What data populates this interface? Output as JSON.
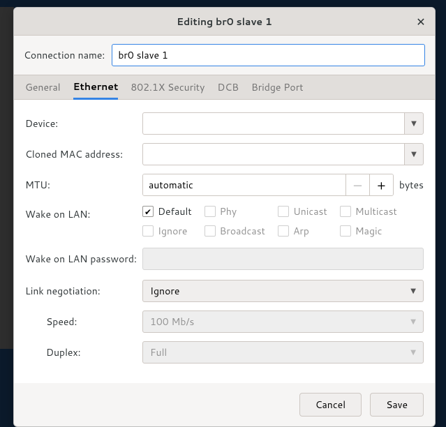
{
  "titlebar": {
    "title": "Editing br0 slave 1"
  },
  "connection_name": {
    "label": "Connection name:",
    "value": "br0 slave 1"
  },
  "tabs": {
    "general": "General",
    "ethernet": "Ethernet",
    "security": "802.1X Security",
    "dcb": "DCB",
    "bridge": "Bridge Port"
  },
  "ethernet": {
    "device": {
      "label": "Device:",
      "value": ""
    },
    "cloned_mac": {
      "label": "Cloned MAC address:",
      "value": ""
    },
    "mtu": {
      "label": "MTU:",
      "value": "automatic",
      "unit": "bytes"
    },
    "wol": {
      "label": "Wake on LAN:",
      "default": {
        "label": "Default",
        "checked": true
      },
      "phy": {
        "label": "Phy",
        "checked": false
      },
      "unicast": {
        "label": "Unicast",
        "checked": false
      },
      "multicast": {
        "label": "Multicast",
        "checked": false
      },
      "ignore": {
        "label": "Ignore",
        "checked": false
      },
      "broadcast": {
        "label": "Broadcast",
        "checked": false
      },
      "arp": {
        "label": "Arp",
        "checked": false
      },
      "magic": {
        "label": "Magic",
        "checked": false
      }
    },
    "wol_password": {
      "label": "Wake on LAN password:",
      "value": ""
    },
    "link_neg": {
      "label": "Link negotiation:",
      "value": "Ignore"
    },
    "speed": {
      "label": "Speed:",
      "value": "100 Mb/s"
    },
    "duplex": {
      "label": "Duplex:",
      "value": "Full"
    }
  },
  "footer": {
    "cancel": "Cancel",
    "save": "Save"
  }
}
